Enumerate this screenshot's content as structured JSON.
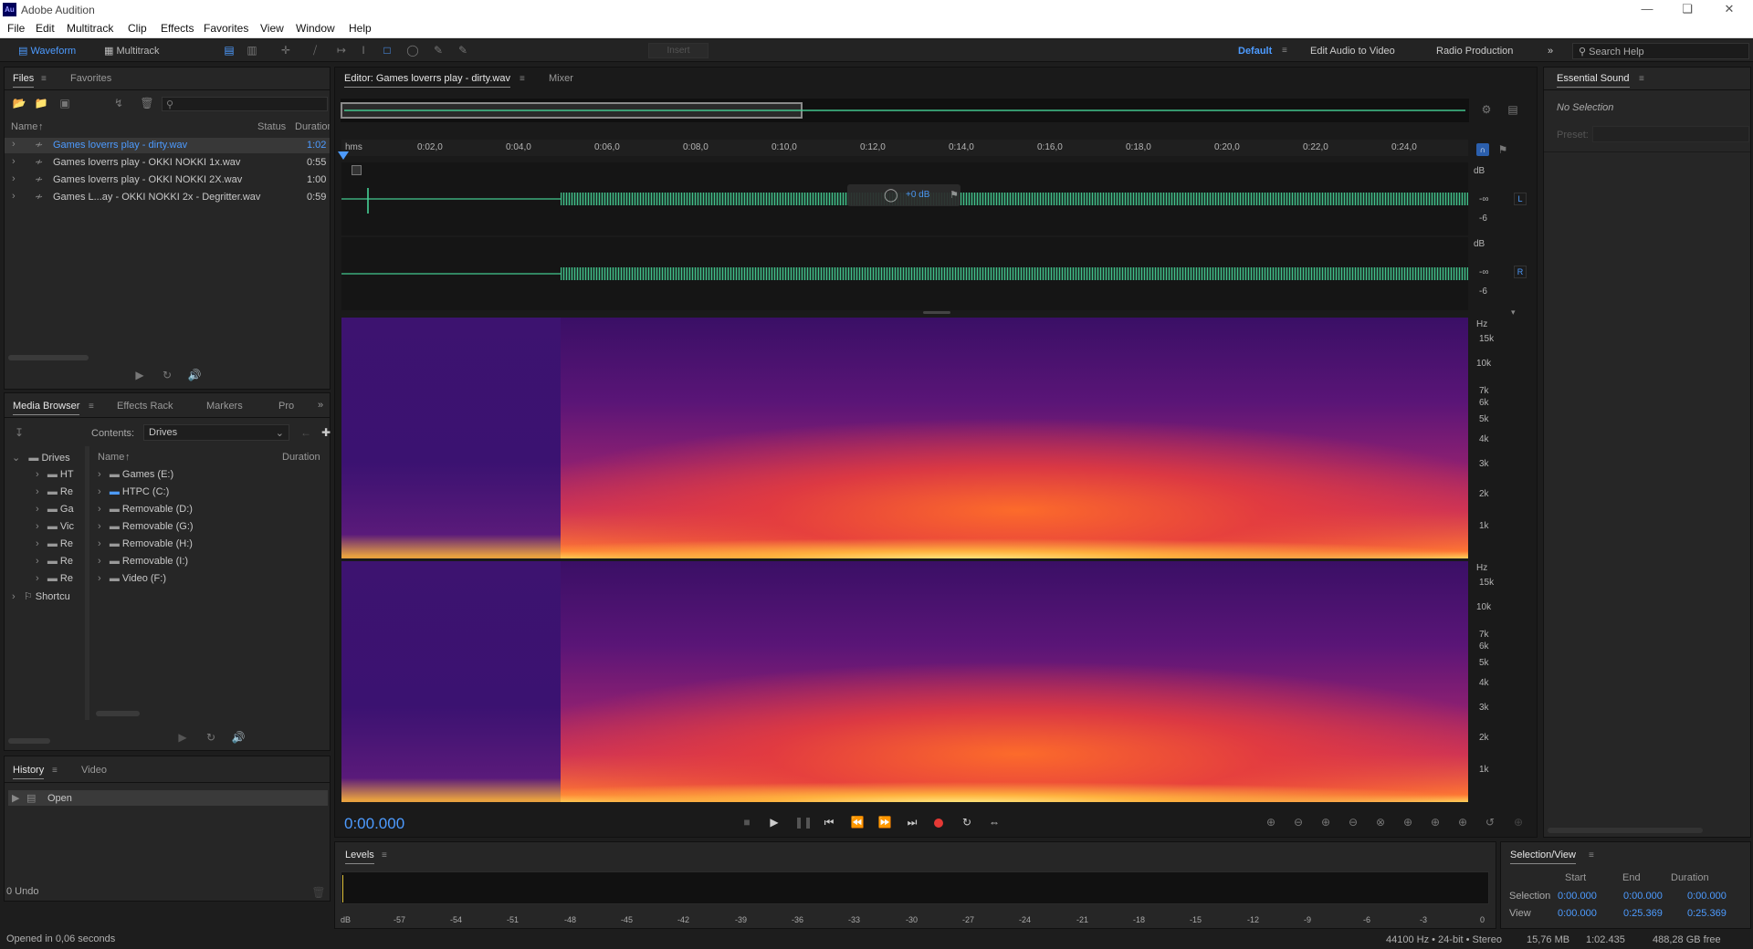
{
  "app": {
    "title": "Adobe Audition",
    "logo": "Au"
  },
  "menu": [
    "File",
    "Edit",
    "Multitrack",
    "Clip",
    "Effects",
    "Favorites",
    "View",
    "Window",
    "Help"
  ],
  "toolbar": {
    "waveform": "Waveform",
    "multitrack": "Multitrack",
    "insert": "Insert",
    "workspaces": [
      "Default",
      "Edit Audio to Video",
      "Radio Production"
    ],
    "search_placeholder": "Search Help"
  },
  "files_panel": {
    "tabs": [
      "Files",
      "Favorites"
    ],
    "columns": [
      "Name",
      "Status",
      "Duration"
    ],
    "rows": [
      {
        "name": "Games loverrs play - dirty.wav",
        "duration": "1:02"
      },
      {
        "name": "Games loverrs play - OKKI NOKKI 1x.wav",
        "duration": "0:55"
      },
      {
        "name": "Games loverrs play - OKKI NOKKI 2X.wav",
        "duration": "1:00"
      },
      {
        "name": "Games L...ay - OKKI NOKKI 2x - Degritter.wav",
        "duration": "0:59"
      }
    ]
  },
  "media_browser": {
    "tabs": [
      "Media Browser",
      "Effects Rack",
      "Markers",
      "Pro"
    ],
    "contents_label": "Contents:",
    "contents_value": "Drives",
    "tree": [
      "Drives",
      "HT",
      "Re",
      "Ga",
      "Vic",
      "Re",
      "Re",
      "Re",
      "Shortcu"
    ],
    "columns": [
      "Name",
      "Duration"
    ],
    "drives": [
      "Games (E:)",
      "HTPC (C:)",
      "Removable (D:)",
      "Removable (G:)",
      "Removable (H:)",
      "Removable (I:)",
      "Video (F:)"
    ]
  },
  "history": {
    "tabs": [
      "History",
      "Video"
    ],
    "items": [
      "Open"
    ],
    "undo": "0 Undo"
  },
  "status_left": "Opened in 0,06 seconds",
  "editor": {
    "tabs": [
      "Editor: Games loverrs play - dirty.wav",
      "Mixer"
    ],
    "ruler": [
      "hms",
      "0:02,0",
      "0:04,0",
      "0:06,0",
      "0:08,0",
      "0:10,0",
      "0:12,0",
      "0:14,0",
      "0:16,0",
      "0:18,0",
      "0:20,0",
      "0:22,0",
      "0:24,0"
    ],
    "db_labels": [
      "dB",
      "-∞",
      "-6",
      "dB",
      "-∞",
      "-6"
    ],
    "channels": [
      "L",
      "R"
    ],
    "hud_gain": "+0 dB",
    "hz_labels": [
      "Hz",
      "15k",
      "10k",
      "7k",
      "6k",
      "5k",
      "4k",
      "3k",
      "2k",
      "1k"
    ],
    "time": "0:00.000"
  },
  "essential_sound": {
    "title": "Essential Sound",
    "status": "No Selection",
    "preset_label": "Preset:"
  },
  "levels": {
    "title": "Levels",
    "scale": [
      "dB",
      "-57",
      "-54",
      "-51",
      "-48",
      "-45",
      "-42",
      "-39",
      "-36",
      "-33",
      "-30",
      "-27",
      "-24",
      "-21",
      "-18",
      "-15",
      "-12",
      "-9",
      "-6",
      "-3",
      "0"
    ]
  },
  "selection_view": {
    "title": "Selection/View",
    "columns": [
      "Start",
      "End",
      "Duration"
    ],
    "selection": {
      "label": "Selection",
      "start": "0:00.000",
      "end": "0:00.000",
      "duration": "0:00.000"
    },
    "view": {
      "label": "View",
      "start": "0:00.000",
      "end": "0:25.369",
      "duration": "0:25.369"
    }
  },
  "status_bar": [
    "44100 Hz • 24-bit • Stereo",
    "15,76 MB",
    "1:02.435",
    "488,28 GB free"
  ],
  "colors": {
    "accent": "#4d9bff",
    "waveform": "#46d296",
    "record": "#e53935"
  }
}
